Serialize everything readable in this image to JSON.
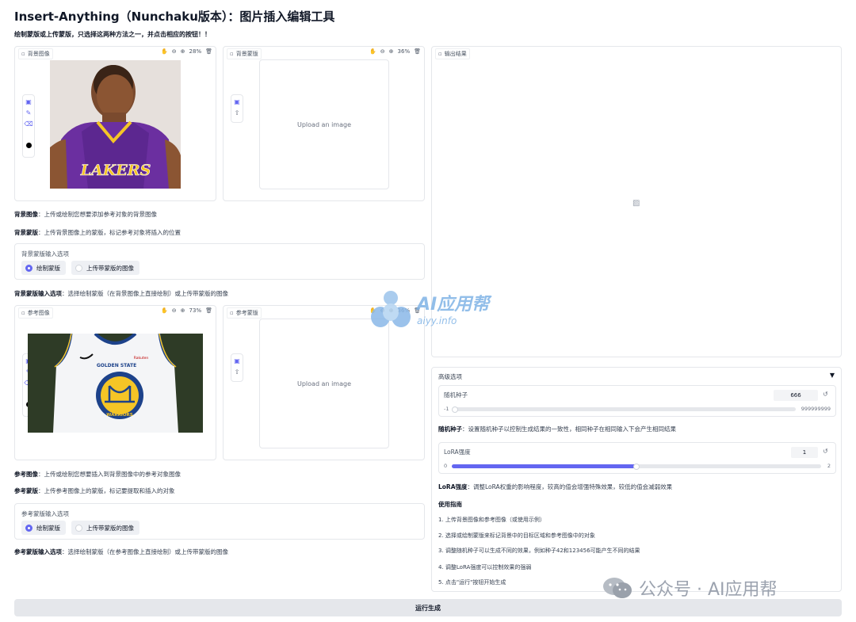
{
  "title": "Insert-Anything（Nunchaku版本）：图片插入编辑工具",
  "instruction": "绘制蒙版或上传蒙版，只选择这两种方法之一，并点击相应的按钮！！",
  "bg_image_panel": {
    "label": "背景图像",
    "zoom": "28%"
  },
  "bg_mask_panel": {
    "label": "背景蒙版",
    "zoom": "36%",
    "upload_text": "Upload an image"
  },
  "output_panel": {
    "label": "输出结果"
  },
  "ref_image_panel": {
    "label": "参考图像",
    "zoom": "73%"
  },
  "ref_mask_panel": {
    "label": "参考蒙版",
    "zoom": "36%",
    "upload_text": "Upload an image"
  },
  "desc": {
    "bg_image_title": "背景图像",
    "bg_image_text": "：上传或绘制您想要添加参考对象的背景图像",
    "bg_mask_title": "背景蒙版",
    "bg_mask_text": "：上传背景图像上的蒙版，标记参考对象将插入的位置",
    "bg_option_title": "背景蒙版输入选项",
    "bg_option_text": "：选择绘制蒙版（在背景图像上直接绘制）或上传带蒙版的图像",
    "ref_image_title": "参考图像",
    "ref_image_text": "：上传或绘制您想要插入到背景图像中的参考对象图像",
    "ref_mask_title": "参考蒙版",
    "ref_mask_text": "：上传参考图像上的蒙版，标记要提取和插入的对象",
    "ref_option_title": "参考蒙版输入选项",
    "ref_option_text": "：选择绘制蒙版（在参考图像上直接绘制）或上传带蒙版的图像"
  },
  "bg_mask_options": {
    "label": "背景蒙版输入选项",
    "options": [
      "绘制蒙版",
      "上传带蒙版的图像"
    ],
    "selected": "绘制蒙版"
  },
  "ref_mask_options": {
    "label": "参考蒙版输入选项",
    "options": [
      "绘制蒙版",
      "上传带蒙版的图像"
    ],
    "selected": "绘制蒙版"
  },
  "advanced": {
    "title": "高级选项",
    "seed": {
      "label": "随机种子",
      "value": "666",
      "min": "-1",
      "max": "999999999",
      "fraction": 0.0
    },
    "seed_desc_title": "随机种子",
    "seed_desc_text": "：设置随机种子以控制生成结果的一致性，相同种子在相同输入下会产生相同结果",
    "lora": {
      "label": "LoRA强度",
      "value": "1",
      "min": "0",
      "max": "2",
      "fraction": 0.5
    },
    "lora_desc_title": "LoRA强度",
    "lora_desc_text": "：调整LoRA权重的影响程度，较高的值会增强特殊效果，较低的值会减弱效果",
    "guide_title": "使用指南",
    "guide_items": [
      "1. 上传背景图像和参考图像（或使用示例）",
      "2. 选择或绘制蒙版来标记背景中的目标区域和参考图像中的对象",
      "3. 调整随机种子可以生成不同的效果，例如种子42和123456可能产生不同的结果",
      "4. 调整LoRA强度可以控制效果的强弱",
      "5. 点击\"运行\"按钮开始生成"
    ]
  },
  "run_button": "运行生成",
  "watermark": {
    "text1": "AI应用帮",
    "text2": "aiyy.info"
  },
  "wechat_watermark": "公众号 · AI应用帮",
  "jersey_text": {
    "state": "GOLDEN STATE",
    "team": "WARRIORS",
    "sponsor": "Rakuten"
  },
  "kobe_jersey_text": "LAKERS"
}
